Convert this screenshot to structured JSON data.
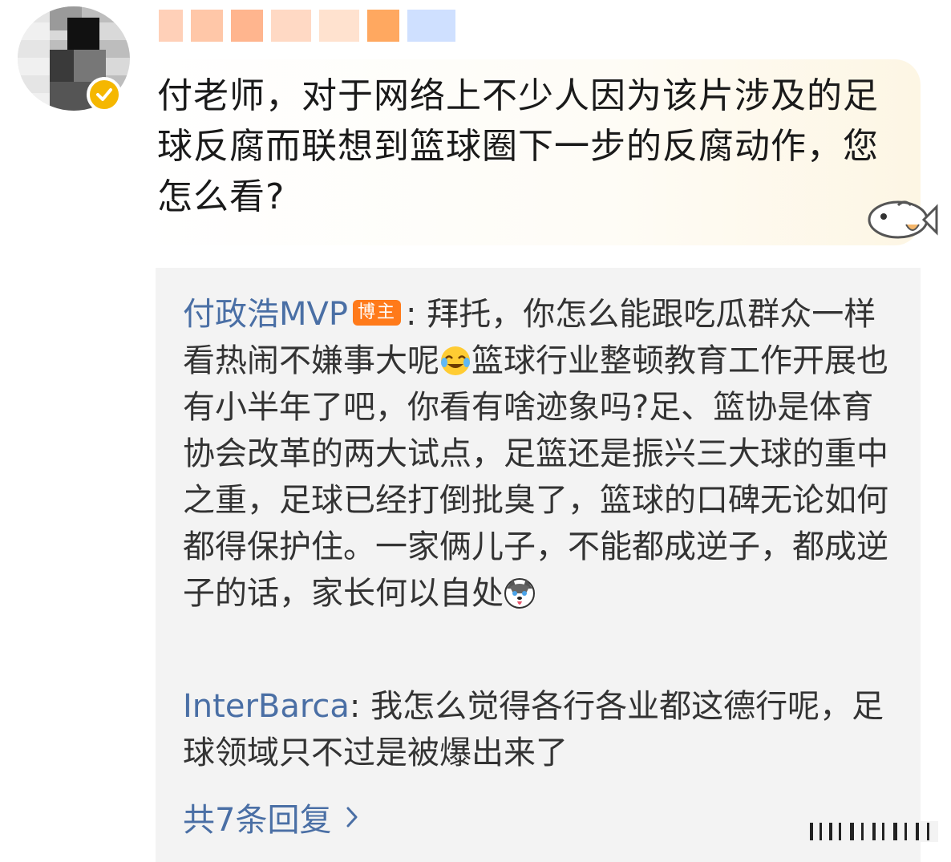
{
  "comment": {
    "text": "付老师，对于网络上不少人因为该片涉及的足球反腐而联想到篮球圈下一步的反腐动作，您怎么看?"
  },
  "replies": [
    {
      "author": "付政浩MVP",
      "badge": "博主",
      "text_a": "拜托，你怎么能跟吃瓜群众一样看热闹不嫌事大呢",
      "text_b": "篮球行业整顿教育工作开展也有小半年了吧，你看有啥迹象吗?足、篮协是体育协会改革的两大试点，足篮还是振兴三大球的重中之重，足球已经打倒批臭了，篮球的口碑无论如何都得保护住。一家俩儿子，不能都成逆子，都成逆子的话，家长何以自处"
    },
    {
      "author": "InterBarca",
      "text": "我怎么觉得各行各业都这德行呢，足球领域只不过是被爆出来了"
    }
  ],
  "more_replies": "共7条回复",
  "icons": {
    "verified": "verified-badge-icon",
    "laugh_cry": "laugh-cry-emoji-icon",
    "husky": "husky-emoji-icon",
    "fish": "fish-sticker-icon",
    "chevron": "chevron-right-icon"
  },
  "colors": {
    "link": "#4a6fa5",
    "badge": "#ff7a1a",
    "verified": "#f5b700"
  }
}
